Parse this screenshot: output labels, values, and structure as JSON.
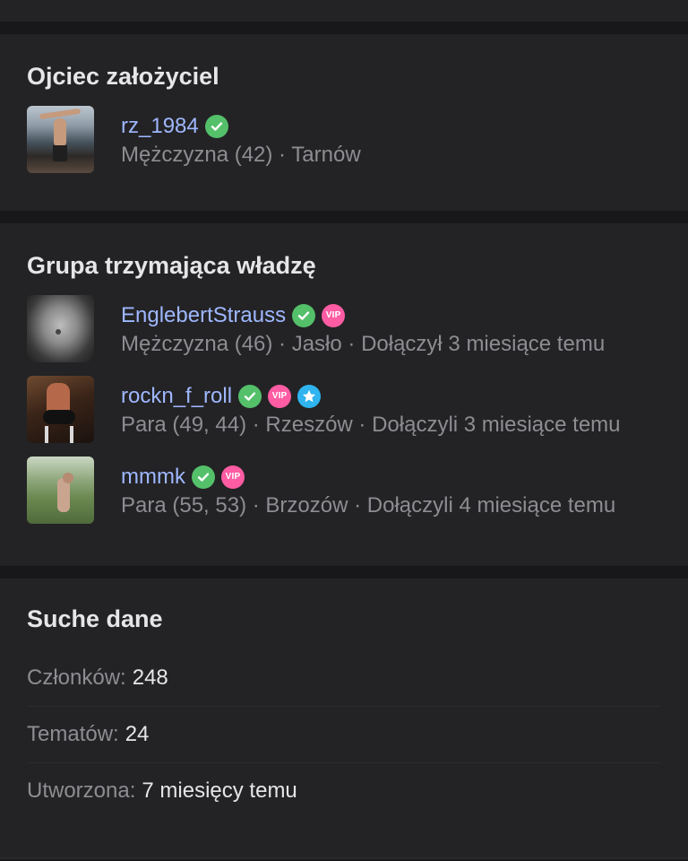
{
  "founder": {
    "title": "Ojciec założyciel",
    "member": {
      "username": "rz_1984",
      "meta": "Mężczyzna (42) · Tarnów",
      "badges": [
        "verified"
      ]
    }
  },
  "leaders": {
    "title": "Grupa trzymająca władzę",
    "members": [
      {
        "username": "EnglebertStrauss",
        "meta": "Mężczyzna (46) · Jasło · Dołączył 3 miesiące temu",
        "badges": [
          "verified",
          "vip"
        ]
      },
      {
        "username": "rockn_f_roll",
        "meta": "Para (49, 44) · Rzeszów · Dołączyli 3 miesiące temu",
        "badges": [
          "verified",
          "vip",
          "star"
        ]
      },
      {
        "username": "mmmk",
        "meta": "Para (55, 53) · Brzozów · Dołączyli 4 miesiące temu",
        "badges": [
          "verified",
          "vip"
        ]
      }
    ]
  },
  "stats": {
    "title": "Suche dane",
    "rows": [
      {
        "label": "Członków:",
        "value": "248"
      },
      {
        "label": "Tematów:",
        "value": "24"
      },
      {
        "label": "Utworzona:",
        "value": "7 miesięcy temu"
      }
    ]
  },
  "badge_text": {
    "vip": "VIP"
  },
  "icons": {
    "verified": "check-circle-icon",
    "vip": "vip-icon",
    "star": "star-icon"
  },
  "colors": {
    "username": "#9fb7ff",
    "verified": "#54c06a",
    "vip": "#ff5ca3",
    "star": "#2fb4f0"
  }
}
